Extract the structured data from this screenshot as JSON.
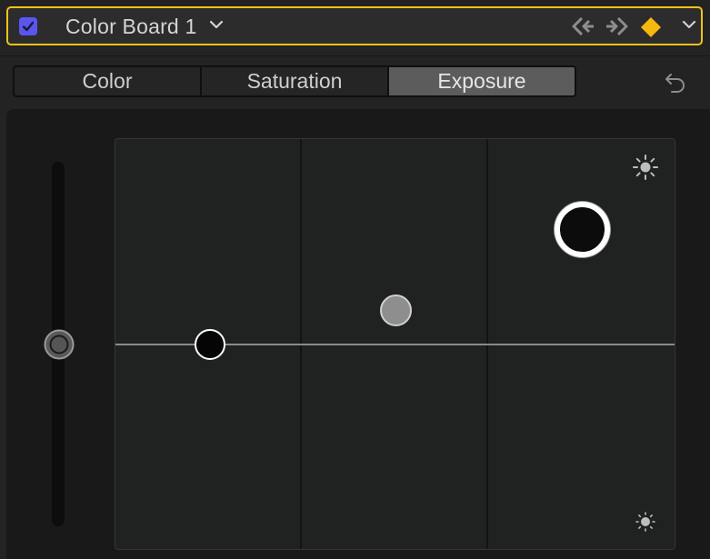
{
  "header": {
    "enabled": true,
    "title": "Color Board 1",
    "accent_color": "#f2c21a",
    "checkbox_color": "#5b55f0",
    "icons": {
      "previous_keyframe": "previous-keyframe-icon",
      "next_keyframe": "next-keyframe-icon",
      "keyframe": "keyframe-diamond-icon",
      "menu": "chevron-down-icon"
    }
  },
  "tabs": [
    {
      "label": "Color",
      "active": false
    },
    {
      "label": "Saturation",
      "active": false
    },
    {
      "label": "Exposure",
      "active": true
    }
  ],
  "reset_icon": "reset-arrow-icon",
  "board": {
    "type": "exposure",
    "pucks": [
      "master",
      "shadows",
      "midtones",
      "highlights"
    ],
    "icons": {
      "top_right": "sun-icon",
      "bottom_right": "sun-small-icon"
    }
  }
}
